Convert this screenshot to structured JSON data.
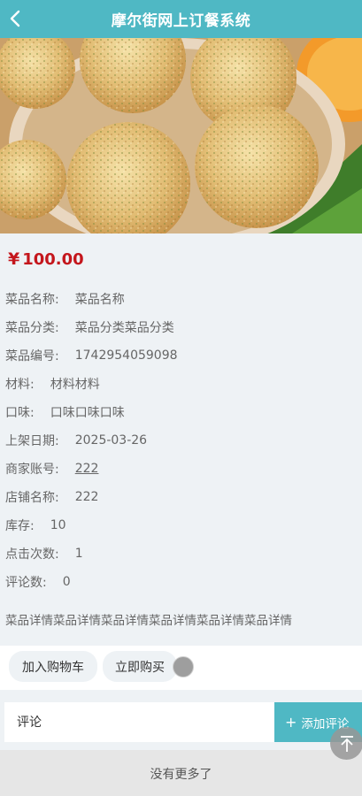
{
  "header": {
    "title": "摩尔街网上订餐系统",
    "back_icon": "chevron-left-icon"
  },
  "product": {
    "currency": "¥",
    "price": "100.00",
    "fields": [
      {
        "key": "菜品名称:",
        "value": "菜品名称"
      },
      {
        "key": "菜品分类:",
        "value": "菜品分类菜品分类"
      },
      {
        "key": "菜品编号:",
        "value": "1742954059098"
      },
      {
        "key": "材料:",
        "value": "材料材料"
      },
      {
        "key": "口味:",
        "value": "口味口味口味"
      },
      {
        "key": "上架日期:",
        "value": "2025-03-26"
      },
      {
        "key": "商家账号:",
        "value": "222"
      },
      {
        "key": "店铺名称:",
        "value": "222"
      },
      {
        "key": "库存:",
        "value": "10"
      },
      {
        "key": "点击次数:",
        "value": "1"
      },
      {
        "key": "评论数:",
        "value": "0"
      }
    ],
    "description": "菜品详情菜品详情菜品详情菜品详情菜品详情菜品详情"
  },
  "actions": {
    "add_to_cart": "加入购物车",
    "buy_now": "立即购买"
  },
  "comment": {
    "placeholder": "评论",
    "add_label": "添加评论"
  },
  "footer": {
    "more": "没有更多了"
  },
  "colors": {
    "primary": "#4fb8c4",
    "price": "#c4161c"
  }
}
